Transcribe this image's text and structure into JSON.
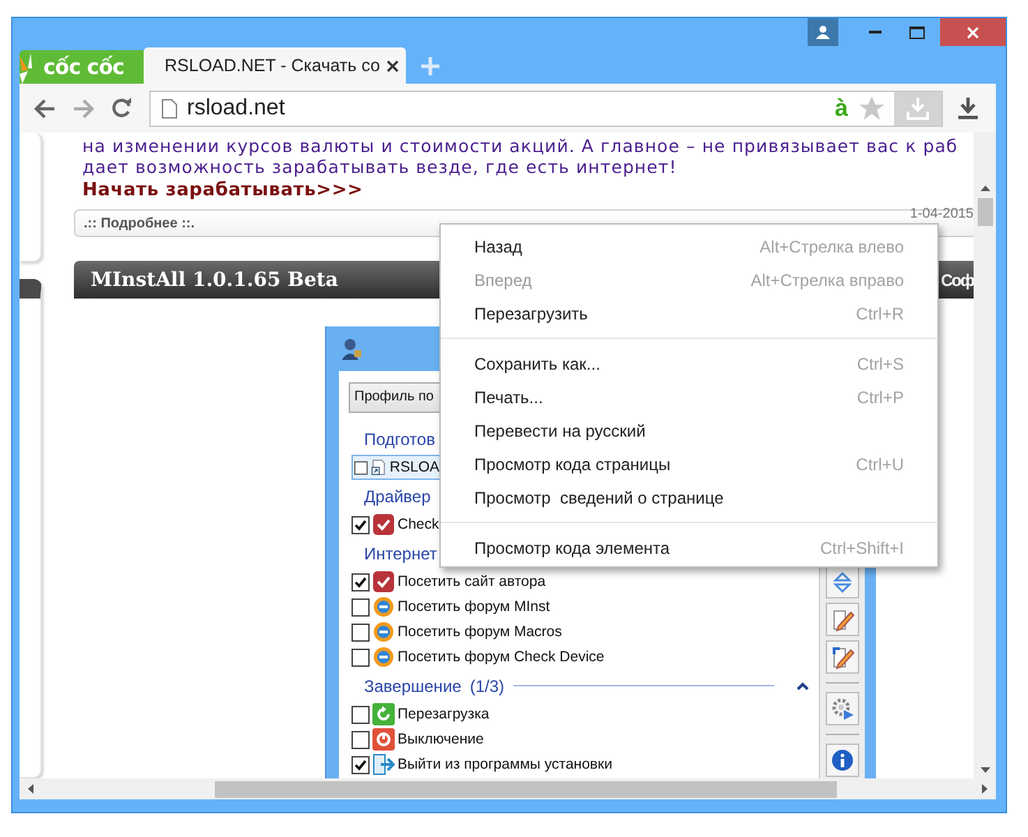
{
  "browser": {
    "logo": "cốc cốc",
    "tabs": [
      {
        "label": "RSLOAD.NET - Скачать со",
        "selected": true
      }
    ],
    "address": "rsload.net",
    "translate_mark": "à"
  },
  "page": {
    "lines": [
      "на изменении курсов валюты и стоимости акций. А главное – не привязывает вас к раб",
      "дает возможность зарабатывать везде, где есть интернет!"
    ],
    "link": "Начать зарабатывать>>>",
    "more": ".:: Подробнее ::.",
    "date": "1-04-2015",
    "heading": "MInstAll 1.0.1.65 Beta",
    "heading_right": "Соф"
  },
  "app": {
    "profile": "Профиль по",
    "groups": [
      {
        "title": "Подготов",
        "rows": [
          {
            "label": "RSLOA",
            "kind": "shortcut",
            "checked": false,
            "selected": true
          }
        ]
      },
      {
        "title": "Драйвер",
        "rows": [
          {
            "label": "Check",
            "kind": "check",
            "checked": true,
            "selected": false
          }
        ]
      },
      {
        "title": "Интернет",
        "rows": [
          {
            "label": "Посетить сайт автора",
            "kind": "check",
            "checked": true,
            "selected": false
          },
          {
            "label": "Посетить форум MInst",
            "kind": "forum",
            "checked": false,
            "selected": false
          },
          {
            "label": "Посетить форум Macros",
            "kind": "forum",
            "checked": false,
            "selected": false
          },
          {
            "label": "Посетить форум Check Device",
            "kind": "forum",
            "checked": false,
            "selected": false
          }
        ]
      },
      {
        "title": "Завершение",
        "count": "(1/3)",
        "expanded": true,
        "rows": [
          {
            "label": "Перезагрузка",
            "kind": "restart",
            "checked": false,
            "selected": false
          },
          {
            "label": "Выключение",
            "kind": "shutdown",
            "checked": false,
            "selected": false
          },
          {
            "label": "Выйти из программы установки",
            "kind": "exit",
            "checked": true,
            "selected": false
          }
        ]
      }
    ],
    "tools": [
      {
        "kind": "updown"
      },
      {
        "kind": "edit"
      },
      {
        "kind": "edit-mark"
      },
      {
        "kind": "separator"
      },
      {
        "kind": "gear"
      },
      {
        "kind": "separator"
      },
      {
        "kind": "info"
      }
    ]
  },
  "context_menu": [
    {
      "kind": "item",
      "label": "Назад",
      "shortcut": "Alt+Стрелка влево",
      "disabled": false
    },
    {
      "kind": "item",
      "label": "Вперед",
      "shortcut": "Alt+Стрелка вправо",
      "disabled": true
    },
    {
      "kind": "item",
      "label": "Перезагрузить",
      "shortcut": "Ctrl+R",
      "disabled": false
    },
    {
      "kind": "separator"
    },
    {
      "kind": "item",
      "label": "Сохранить как...",
      "shortcut": "Ctrl+S",
      "disabled": false
    },
    {
      "kind": "item",
      "label": "Печать...",
      "shortcut": "Ctrl+P",
      "disabled": false
    },
    {
      "kind": "item",
      "label": "Перевести на русский",
      "disabled": false
    },
    {
      "kind": "item",
      "label": "Просмотр кода страницы",
      "shortcut": "Ctrl+U",
      "disabled": false
    },
    {
      "kind": "item",
      "label": "Просмотр  сведений о странице",
      "disabled": false
    },
    {
      "kind": "separator"
    },
    {
      "kind": "item",
      "label": "Просмотр кода элемента",
      "shortcut": "Ctrl+Shift+I",
      "disabled": false
    }
  ]
}
